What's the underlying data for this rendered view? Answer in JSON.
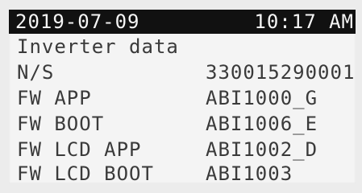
{
  "status_bar": {
    "date": "2019-07-09",
    "time": "10:17 AM"
  },
  "screen_title": "Inverter data",
  "rows": [
    {
      "label": "N/S",
      "value": "330015290001"
    },
    {
      "label": "FW APP",
      "value": "ABI1000_G"
    },
    {
      "label": "FW BOOT",
      "value": "ABI1006_E"
    },
    {
      "label": "FW LCD APP",
      "value": "ABI1002_D"
    },
    {
      "label": "FW LCD BOOT",
      "value": "ABI1003"
    }
  ],
  "colors": {
    "status_bar_bg": "#111111",
    "status_bar_text": "#f5f5f5",
    "screen_bg": "#f4f4f4",
    "text": "#3a3a3a"
  }
}
